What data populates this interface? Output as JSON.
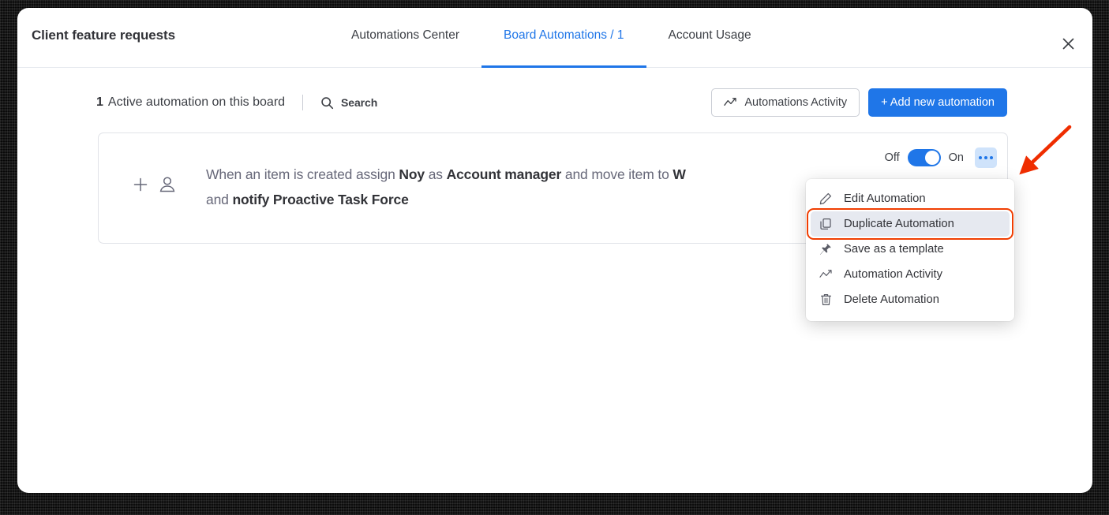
{
  "header": {
    "board_title": "Client feature requests",
    "tabs": [
      {
        "label": "Automations Center",
        "active": false
      },
      {
        "label": "Board Automations / 1",
        "active": true
      },
      {
        "label": "Account Usage",
        "active": false
      }
    ],
    "close_icon": "close-icon"
  },
  "toolbar": {
    "count": "1",
    "count_text": "Active automation on this board",
    "search_label": "Search",
    "search_icon": "search-icon",
    "activity_button": "Automations Activity",
    "activity_icon": "activity-line-icon",
    "add_button": "+ Add new automation"
  },
  "automation": {
    "add_icon": "plus-icon",
    "person_icon": "person-icon",
    "line1_prefix": "When an item is created assign ",
    "line1_b1": "Noy",
    "line1_mid1": " as ",
    "line1_b2": "Account manager",
    "line1_mid2": " and move item to ",
    "line1_b3": "W",
    "line2_prefix": "and ",
    "line2_b1": "notify Proactive Task Force",
    "off_label": "Off",
    "on_label": "On",
    "toggle_state": "on",
    "more_icon": "more-horizontal-icon"
  },
  "menu": {
    "items": [
      {
        "label": "Edit Automation",
        "icon": "pencil-icon",
        "hovered": false,
        "annotated": false
      },
      {
        "label": "Duplicate Automation",
        "icon": "copy-icon",
        "hovered": true,
        "annotated": true
      },
      {
        "label": "Save as a template",
        "icon": "pin-icon",
        "hovered": false,
        "annotated": false
      },
      {
        "label": "Automation Activity",
        "icon": "activity-line-icon",
        "hovered": false,
        "annotated": false
      },
      {
        "label": "Delete Automation",
        "icon": "trash-icon",
        "hovered": false,
        "annotated": false
      }
    ]
  },
  "annotation": {
    "arrow_color": "#ef2d00",
    "points_to": "more-horizontal-icon"
  },
  "colors": {
    "accent": "#1f76e8",
    "annotation": "#f03e02",
    "text_primary": "#323338",
    "text_secondary": "#676879"
  }
}
